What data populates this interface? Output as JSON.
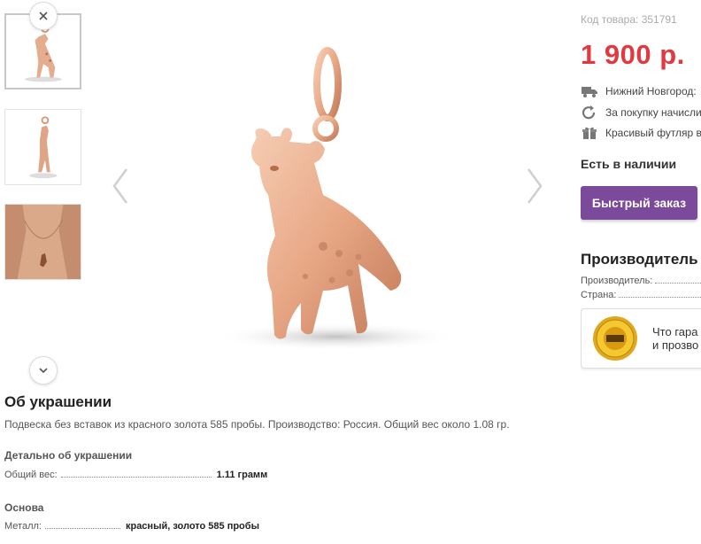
{
  "gallery": {
    "up_button_icon": "close-icon",
    "down_button_icon": "chevron-down-icon",
    "thumbnails": [
      {
        "label": "giraffe-pendant-front"
      },
      {
        "label": "giraffe-pendant-side"
      },
      {
        "label": "pendant-on-neck"
      }
    ],
    "prev_icon": "chevron-left-icon",
    "next_icon": "chevron-right-icon"
  },
  "product": {
    "sku_text": "Код товара: 351791",
    "price": "1 900 р.",
    "features": [
      {
        "icon": "truck-icon",
        "text": "Нижний Новгород:"
      },
      {
        "icon": "refresh-icon",
        "text": "За покупку начисли"
      },
      {
        "icon": "gift-icon",
        "text": "Красивый футляр в"
      }
    ],
    "stock_status": "Есть в наличии",
    "quick_order_label": "Быстрый заказ",
    "manufacturer_title": "Производитель и",
    "manufacturer_rows": [
      {
        "label": "Производитель:"
      },
      {
        "label": "Страна:"
      }
    ],
    "guarantee_text_line1": "Что гара",
    "guarantee_text_line2": "и прозво"
  },
  "description": {
    "title": "Об украшении",
    "summary": "Подвеска без вставок из красного золота 585 пробы. Производство: Россия. Общий вес около 1.08 гр.",
    "details_title": "Детально об украшении",
    "weight_label": "Общий вес:",
    "weight_value": "1.11 грамм",
    "base_title": "Основа",
    "metal_label": "Металл:",
    "metal_value": "красный, золото 585 пробы"
  },
  "colors": {
    "price": "#e2383f",
    "quick_order_button": "#7b4a9a",
    "gold": "#e8a886"
  }
}
